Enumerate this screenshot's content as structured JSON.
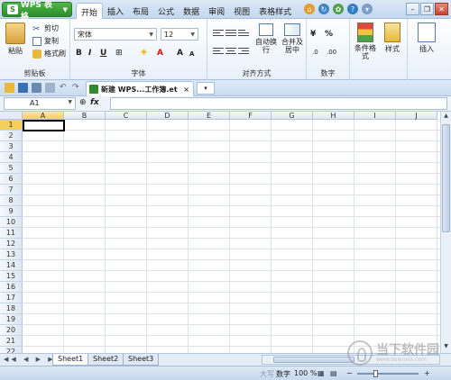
{
  "app": {
    "name": "WPS 表格",
    "logo_letter": "S"
  },
  "menu_tabs": [
    "开始",
    "插入",
    "布局",
    "公式",
    "数据",
    "审阅",
    "视图",
    "表格样式"
  ],
  "active_tab": "开始",
  "ribbon": {
    "clipboard": {
      "paste": "粘贴",
      "cut": "剪切",
      "copy": "复制",
      "format_painter": "格式刷",
      "group_label": "剪贴板"
    },
    "font": {
      "family": "宋体",
      "size": "12",
      "bold": "B",
      "italic": "I",
      "underline": "U",
      "grow": "A",
      "shrink": "A",
      "font_color": "A",
      "group_label": "字体"
    },
    "alignment": {
      "wrap": "自动换行",
      "merge": "合并及居中",
      "group_label": "对齐方式"
    },
    "number": {
      "currency": "¥",
      "percent": "%",
      "group_label": "数字"
    },
    "styles": {
      "conditional": "条件格式",
      "cell_style": "样式"
    },
    "insert": "插入"
  },
  "document_tab": {
    "title": "新建 WPS...工作簿.et",
    "close": "×"
  },
  "formula_bar": {
    "name_box": "A1",
    "fx": "fx",
    "value": ""
  },
  "columns": [
    "A",
    "B",
    "C",
    "D",
    "E",
    "F",
    "G",
    "H",
    "I",
    "J"
  ],
  "rows": [
    "1",
    "2",
    "3",
    "4",
    "5",
    "6",
    "7",
    "8",
    "9",
    "10",
    "11",
    "12",
    "13",
    "14",
    "15",
    "16",
    "17",
    "18",
    "19",
    "20",
    "21",
    "22"
  ],
  "selected_cell": "A1",
  "sheets": [
    "Sheet1",
    "Sheet2",
    "Sheet3"
  ],
  "active_sheet": "Sheet1",
  "status": {
    "mode": "大写",
    "num": "数字",
    "zoom": "100 %",
    "minus": "−",
    "plus": "+"
  },
  "watermark": {
    "text": "当下软件园",
    "sub": "www.downxia.com"
  },
  "colors": {
    "accent": "#2e8c2a",
    "selection": "#f4cf5a",
    "chrome": "#c4d8ef"
  }
}
